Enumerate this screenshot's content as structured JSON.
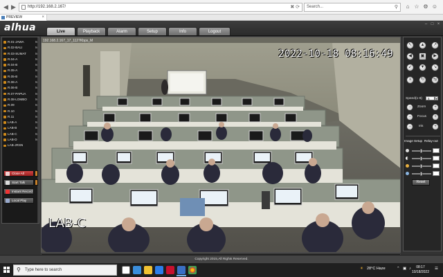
{
  "browser": {
    "url": "http://192.168.2.167/",
    "search_placeholder": "Search...",
    "tab_title": "PREVIEW"
  },
  "app": {
    "logo": "alhua",
    "menu_tabs": [
      "Live",
      "Playback",
      "Alarm",
      "Setup",
      "Info",
      "Logout"
    ],
    "active_tab": "Live",
    "channels": [
      {
        "label": "R.01-JAWA",
        "suffix": "M"
      },
      {
        "label": "R.02-BALI",
        "suffix": "M"
      },
      {
        "label": "R.03-SUMAT",
        "suffix": "M"
      },
      {
        "label": "R.04-A",
        "suffix": "M"
      },
      {
        "label": "R.04-B",
        "suffix": "M"
      },
      {
        "label": "R.05-A",
        "suffix": "M"
      },
      {
        "label": "R.05-B",
        "suffix": "M"
      },
      {
        "label": "R.06-A",
        "suffix": "M"
      },
      {
        "label": "R.06-B",
        "suffix": "M"
      },
      {
        "label": "R.07-PAPUA",
        "suffix": "M"
      },
      {
        "label": "R.08-LOMBO",
        "suffix": "M"
      },
      {
        "label": "R.09",
        "suffix": "M"
      },
      {
        "label": "R.10",
        "suffix": "M"
      },
      {
        "label": "R.11",
        "suffix": "M"
      },
      {
        "label": "LAB-A",
        "suffix": "M"
      },
      {
        "label": "LAB-B",
        "suffix": "M"
      },
      {
        "label": "LAB-C",
        "suffix": "M"
      },
      {
        "label": "LAB-D",
        "suffix": "M"
      },
      {
        "label": "LAB-JRSN",
        "suffix": ""
      }
    ],
    "side_buttons": {
      "close_all": "Close All",
      "start_talk": "Start Talk",
      "instant_record": "Instant Record",
      "local_play": "Local Play"
    },
    "video": {
      "status": "192.168.2.167_17_1127Kbps_M",
      "timestamp": "2022-10-18  08:16:49",
      "camera_name": "LAB-C"
    },
    "ptz": {
      "speed_label": "Speed(1-8)",
      "speed_value": "5",
      "zoom_label": "Zoom",
      "focus_label": "Focus",
      "iris_label": "Iris",
      "image_setup_label": "Image Setup",
      "relay_out_label": "Relay-out",
      "reset_label": "Reset"
    },
    "copyright": "Copyright 2015,All Rights Reserved."
  },
  "taskbar": {
    "search_placeholder": "Type here to search",
    "weather": "28°C  Haze",
    "time": "08:17",
    "date": "10/18/2022"
  },
  "colors": {
    "channel_icon": "#d08a1a",
    "danger_button": "#c03030",
    "active_tab": "#c8c8c8"
  }
}
